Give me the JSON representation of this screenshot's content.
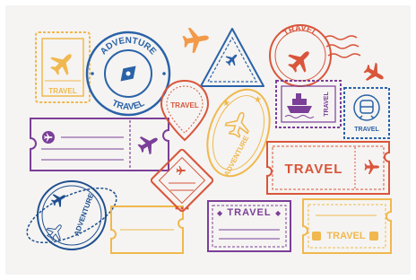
{
  "stamps": {
    "plane_square": {
      "label": "TRAVEL"
    },
    "adventure_circle": {
      "top": "ADVENTURE",
      "bottom": "TRAVEL"
    },
    "pin": {
      "label": "TRAVEL"
    },
    "postmark": {
      "label": "TRAVEL"
    },
    "ship": {
      "label": "TRAVEL"
    },
    "train": {
      "label": "TRAVEL"
    },
    "oval": {
      "label": "ADVENTURE"
    },
    "ticket_right": {
      "label": "TRAVEL"
    },
    "orbit": {
      "label": "ADVENTURE"
    },
    "purple_ribbon": {
      "label": "TRAVEL"
    },
    "yellow_ticket": {
      "label": "TRAVEL"
    }
  },
  "colors": {
    "yellow": "#f0b84e",
    "blue": "#2a62a8",
    "red": "#d9553b",
    "purple": "#7b3f98",
    "orange": "#f29a4a",
    "navy": "#1f4f8f"
  }
}
